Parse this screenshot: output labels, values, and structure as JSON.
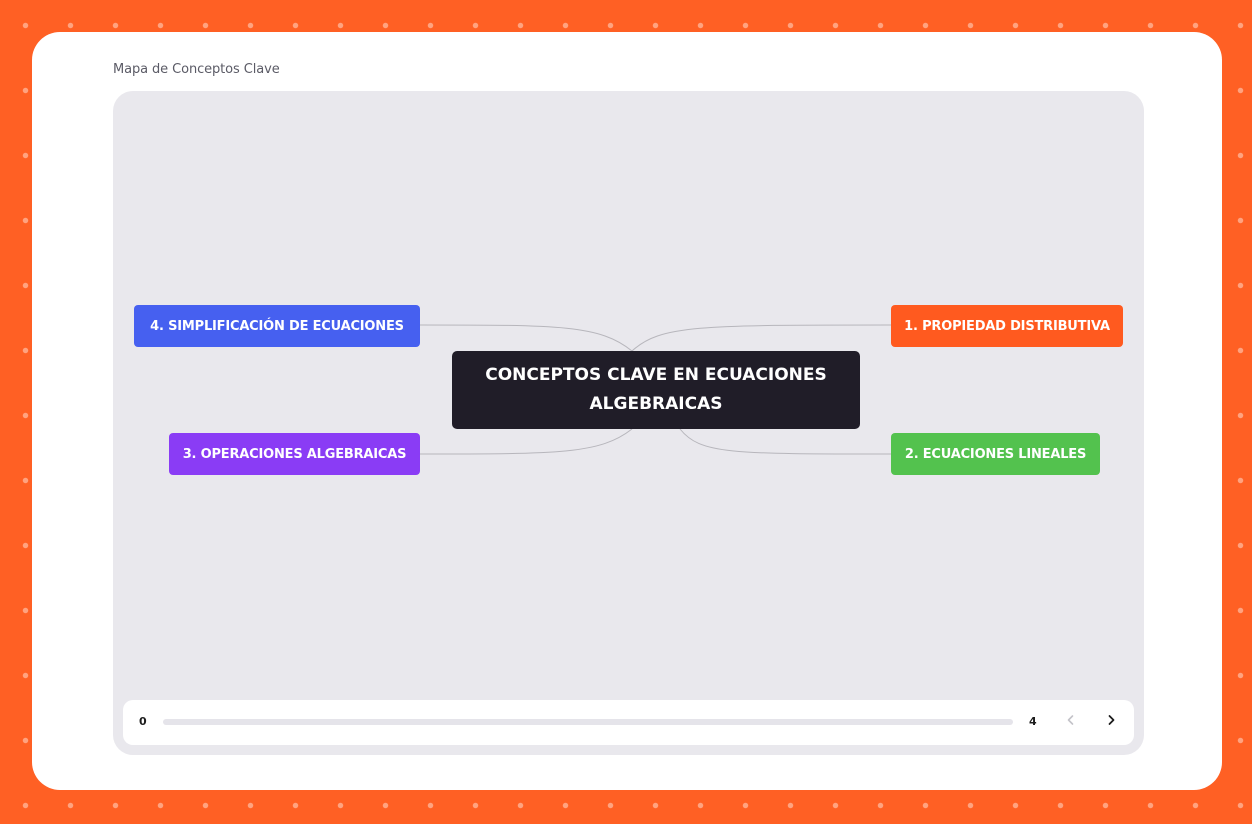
{
  "map": {
    "title": "Mapa de Conceptos Clave",
    "central": "CONCEPTOS CLAVE EN ECUACIONES ALGEBRAICAS",
    "branches": [
      {
        "label": "1. PROPIEDAD DISTRIBUTIVA",
        "color": "#ff5a1f"
      },
      {
        "label": "2. ECUACIONES LINEALES",
        "color": "#53c24e"
      },
      {
        "label": "3. OPERACIONES ALGEBRAICAS",
        "color": "#8a3cf5"
      },
      {
        "label": "4. SIMPLIFICACIÓN DE ECUACIONES",
        "color": "#4660f0"
      }
    ]
  },
  "controls": {
    "start": "0",
    "end": "4",
    "progress": 0,
    "prev_icon": "chevron-left-icon",
    "next_icon": "chevron-right-icon"
  },
  "theme": {
    "background": "#ff6024",
    "central_color": "#201d28"
  }
}
